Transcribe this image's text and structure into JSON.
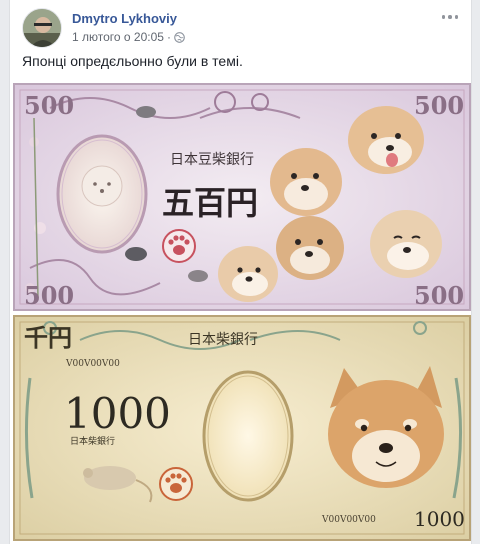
{
  "post": {
    "author": "Dmytro Lykhoviy",
    "timestamp": "1 лютого о 20:05",
    "separator": "·",
    "privacy_icon": "globe-icon",
    "more_icon": "more-options-icon",
    "text": "Японці опредєльонно були в темі."
  },
  "photo": {
    "note_top": {
      "value_big": "五百円",
      "corner_value": "500",
      "bank_name": "日本豆柴銀行",
      "seal_icon": "paw-seal-icon"
    },
    "note_bottom": {
      "header_value": "千円",
      "bank_name": "日本柴銀行",
      "value_big": "1000",
      "corner_value": "1000",
      "serial_top": "V00V00V00",
      "serial_bottom": "V00V00V00",
      "small_bank": "日本柴銀行",
      "seal_icon": "paw-seal-icon"
    }
  },
  "colors": {
    "link": "#385898",
    "meta_gray": "#616770",
    "note_top_bg": "#e7dcea",
    "note_bottom_bg": "#efe2bd"
  }
}
